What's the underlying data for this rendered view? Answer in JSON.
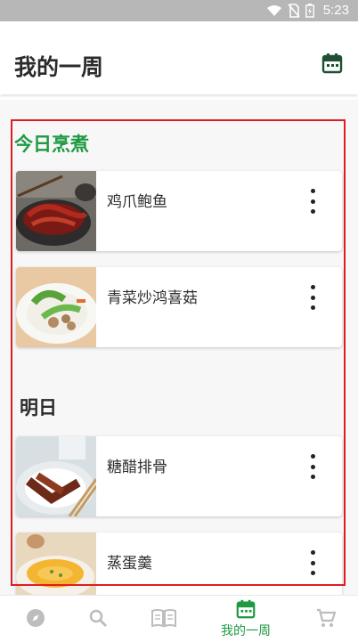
{
  "status_bar": {
    "time": "5:23",
    "icons": [
      "wifi-icon",
      "no-sim-icon",
      "battery-icon"
    ]
  },
  "header": {
    "title": "我的一周",
    "action_icon": "calendar-icon"
  },
  "sections": {
    "today": {
      "title": "今日烹煮",
      "items": [
        {
          "name": "鸡爪鲍鱼"
        },
        {
          "name": "青菜炒鸿喜菇"
        }
      ]
    },
    "tomorrow": {
      "title": "明日",
      "items": [
        {
          "name": "糖醋排骨"
        },
        {
          "name": "蒸蛋羹"
        }
      ]
    }
  },
  "bottom_nav": {
    "items": [
      {
        "icon": "compass-icon",
        "label": ""
      },
      {
        "icon": "search-icon",
        "label": ""
      },
      {
        "icon": "book-icon",
        "label": ""
      },
      {
        "icon": "calendar-icon",
        "label": "我的一周",
        "active": true
      },
      {
        "icon": "cart-icon",
        "label": ""
      }
    ]
  },
  "colors": {
    "accent": "#1f9a43",
    "highlight_border": "#e01b23",
    "status_bar": "#b7b7b7"
  }
}
